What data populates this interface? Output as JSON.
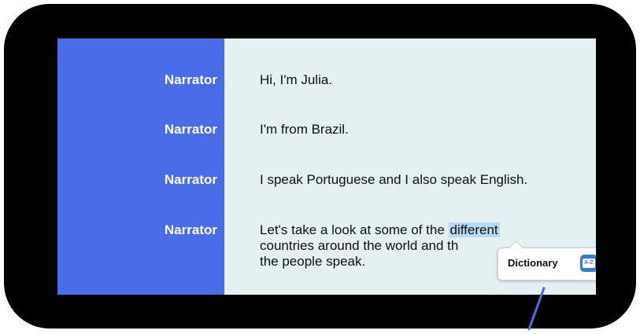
{
  "transcript": [
    {
      "speaker": "Narrator",
      "text": "Hi, I'm Julia."
    },
    {
      "speaker": "Narrator",
      "text": "I'm from Brazil."
    },
    {
      "speaker": "Narrator",
      "text": "I speak Portuguese and I also speak English."
    },
    {
      "speaker": "Narrator",
      "text_before": "Let's take a look at some of the ",
      "highlighted_word": "different",
      "text_line2": "countries around the world and th",
      "text_line3": "the people speak."
    }
  ],
  "popup": {
    "label": "Dictionary",
    "icon": "dictionary-icon"
  },
  "colors": {
    "speaker_column": "#4a6ce9",
    "highlight": "#b7daf5",
    "background": "#e4f0f1"
  }
}
